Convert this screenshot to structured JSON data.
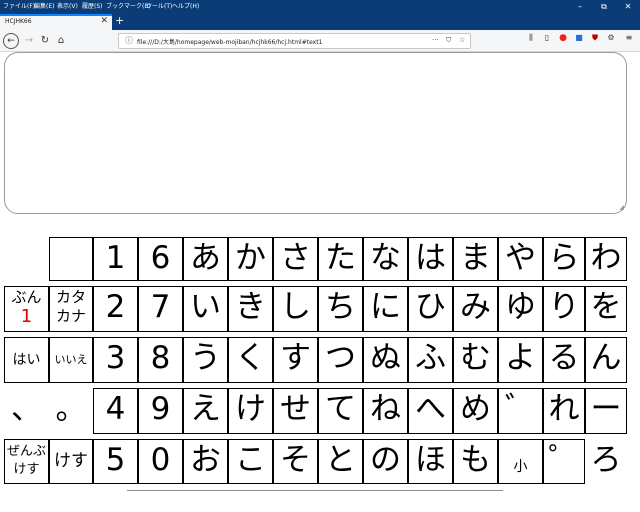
{
  "browser": {
    "menu": [
      "ファイル(F)",
      "編集(E)",
      "表示(V)",
      "履歴(S)",
      "ブックマーク(B)",
      "ツール(T)",
      "ヘルプ(H)"
    ],
    "window_controls": {
      "minimize": "–",
      "restore": "⧉",
      "close": "✕"
    },
    "tab": {
      "title": "HCJHK66",
      "close": "✕"
    },
    "new_tab": "+",
    "url": "file:///D:/大島/homepage/web-mojiban/hcjhk66/hcj.html#text1",
    "url_actions": {
      "more": "···",
      "pocket": "⛉",
      "star": "☆"
    }
  },
  "keys": {
    "r1": [
      "",
      "1",
      "6",
      "あ",
      "か",
      "さ",
      "た",
      "な",
      "は",
      "ま",
      "や",
      "ら",
      "わ"
    ],
    "r2": {
      "bun": "ぶん",
      "bun_num": "1",
      "kata1": "カタ",
      "kata2": "カナ",
      "rest": [
        "2",
        "7",
        "い",
        "き",
        "し",
        "ち",
        "に",
        "ひ",
        "み",
        "ゆ",
        "り",
        "を"
      ]
    },
    "r3": {
      "hai": "はい",
      "iie": "いいえ",
      "rest": [
        "3",
        "8",
        "う",
        "く",
        "す",
        "つ",
        "ぬ",
        "ふ",
        "む",
        "よ",
        "る",
        "ん"
      ]
    },
    "r4": [
      "、",
      "。",
      "4",
      "9",
      "え",
      "け",
      "せ",
      "て",
      "ね",
      "へ",
      "め",
      "゛",
      "れ",
      "ー"
    ],
    "r5": {
      "zenbu1": "ぜんぶ",
      "zenbu2": "けす",
      "kesu": "けす",
      "rest": [
        "5",
        "0",
        "お",
        "こ",
        "そ",
        "と",
        "の",
        "ほ",
        "も"
      ],
      "ko": "小",
      "handaku": "゜",
      "ro": "ろ"
    }
  }
}
